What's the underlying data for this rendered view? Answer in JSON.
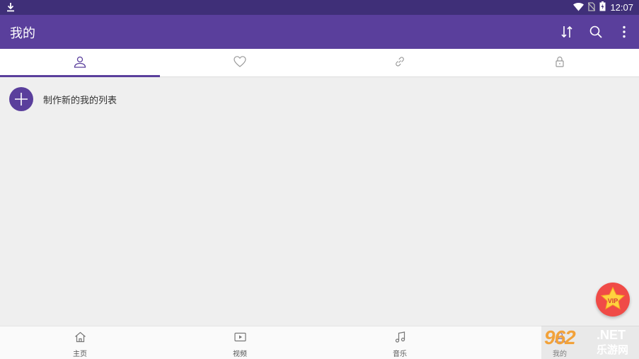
{
  "status_bar": {
    "time": "12:07"
  },
  "app_bar": {
    "title": "我的",
    "actions": [
      "sort-icon",
      "search-icon",
      "more-vert-icon"
    ]
  },
  "tabs": [
    {
      "icon": "person-icon",
      "selected": true
    },
    {
      "icon": "heart-icon",
      "selected": false
    },
    {
      "icon": "link-icon",
      "selected": false
    },
    {
      "icon": "lock-icon",
      "selected": false
    }
  ],
  "content": {
    "new_list_label": "制作新的我的列表"
  },
  "fab": {
    "label": "VIP"
  },
  "bottom_nav": [
    {
      "label": "主页",
      "icon": "home-icon"
    },
    {
      "label": "视频",
      "icon": "video-icon"
    },
    {
      "label": "音乐",
      "icon": "music-icon"
    },
    {
      "label": "我的",
      "icon": "person-icon"
    }
  ],
  "watermark": {
    "number": "962",
    "suffix": ".NET",
    "site": "乐游网"
  },
  "colors": {
    "status_bar": "#3f2f78",
    "app_bar": "#5a3f9c",
    "accent": "#5a3f9c",
    "fab": "#f04b47",
    "background": "#efefef"
  }
}
